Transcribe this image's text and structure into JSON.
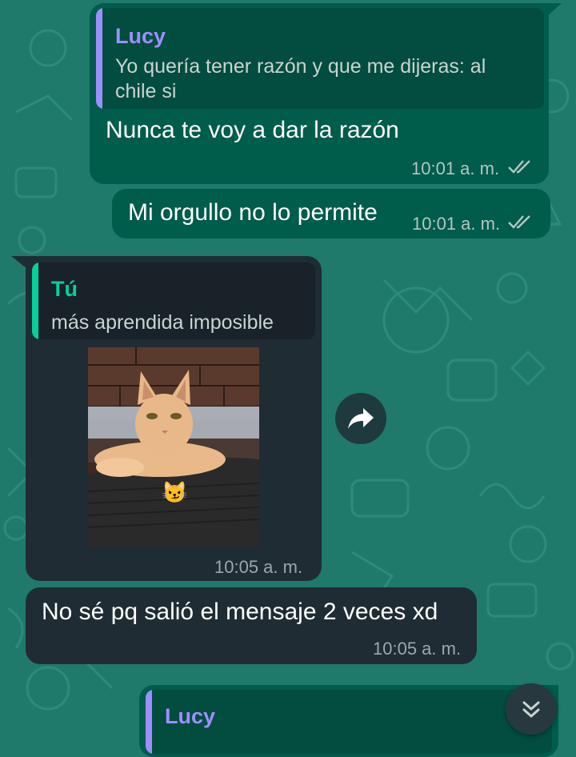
{
  "colors": {
    "wallpaper": "#1f7a6c",
    "outgoing_bubble": "#005c4b",
    "incoming_bubble": "#1f2c34",
    "quote_name_lucy": "#9d8fff",
    "quote_name_tu": "#06cf9c",
    "read_ticks": "#b4c6c1"
  },
  "messages": [
    {
      "direction": "outgoing",
      "quoted": {
        "author": "Lucy",
        "text": "Yo quería tener razón y que me dijeras: al chile si"
      },
      "text": "Nunca te voy a dar la razón",
      "time": "10:01 a. m.",
      "status_icon": "double-check-icon"
    },
    {
      "direction": "outgoing",
      "text": "Mi orgullo no lo permite",
      "time": "10:01 a. m.",
      "status_icon": "double-check-icon"
    },
    {
      "direction": "incoming",
      "quoted": {
        "author": "Tú",
        "text": "más aprendida imposible"
      },
      "media": "cat-photo",
      "sticker_emoji": "😼",
      "time": "10:05 a. m.",
      "action_icon": "forward-icon"
    },
    {
      "direction": "incoming",
      "text": "No sé pq salió el mensaje 2 veces xd",
      "time": "10:05 a. m."
    },
    {
      "direction": "outgoing",
      "quoted": {
        "author": "Lucy"
      }
    }
  ],
  "scroll_button_icon": "chevrons-down-icon"
}
